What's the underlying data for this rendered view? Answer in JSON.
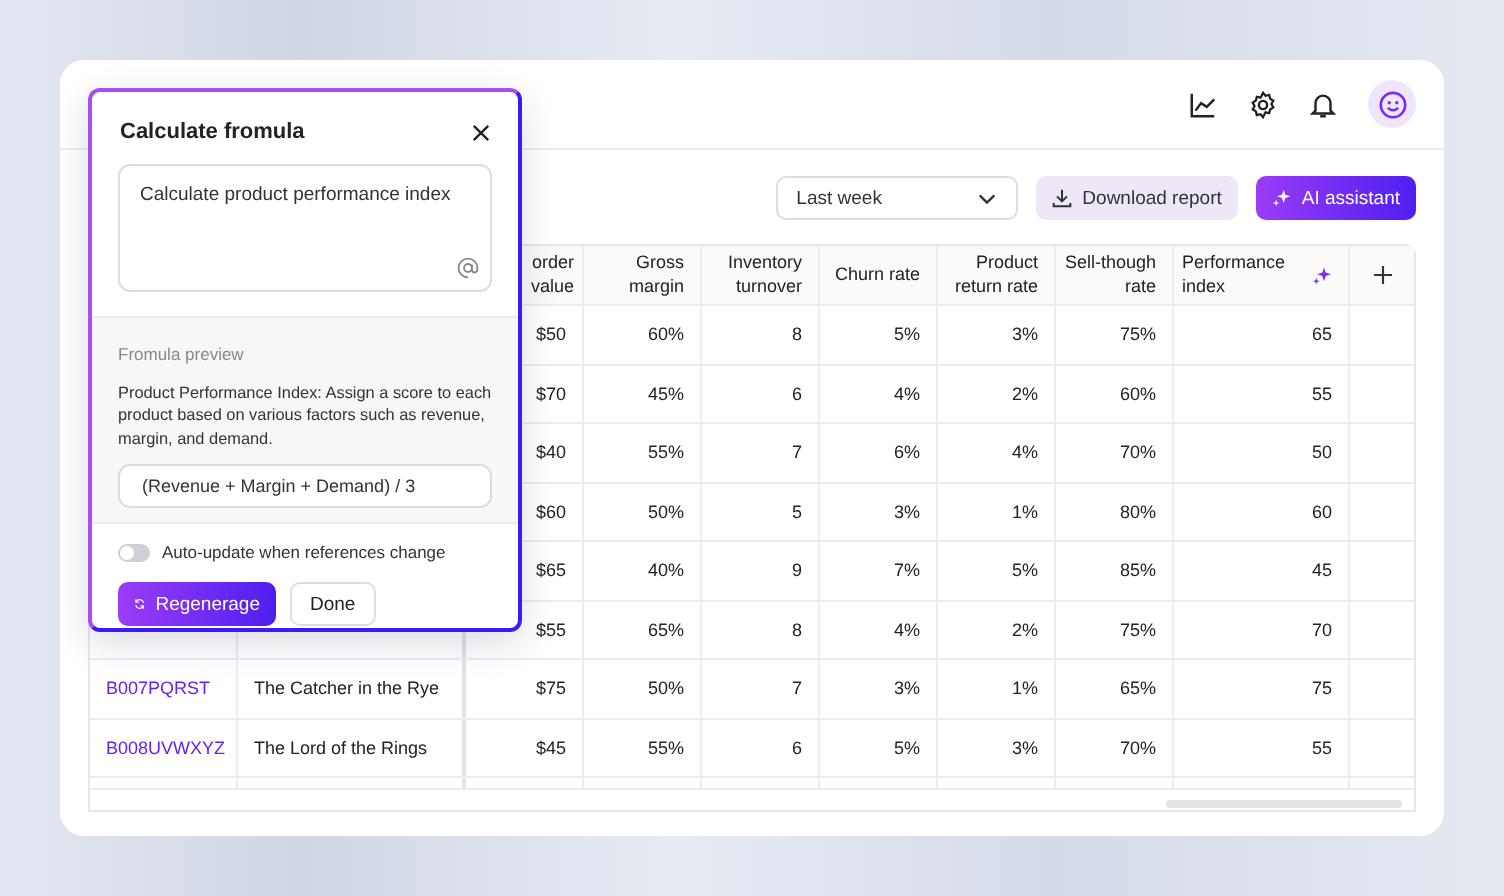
{
  "toolbar": {
    "period": "Last week",
    "download": "Download report",
    "assistant": "AI assistant"
  },
  "table": {
    "columns": [
      "order value",
      "Gross margin",
      "Inventory turnover",
      "Churn rate",
      "Product return rate",
      "Sell-though rate",
      "Performance index"
    ],
    "rows": [
      {
        "cells": [
          "$50",
          "60%",
          "8",
          "5%",
          "3%",
          "75%",
          "65"
        ]
      },
      {
        "cells": [
          "$70",
          "45%",
          "6",
          "4%",
          "2%",
          "60%",
          "55"
        ]
      },
      {
        "cells": [
          "$40",
          "55%",
          "7",
          "6%",
          "4%",
          "70%",
          "50"
        ]
      },
      {
        "cells": [
          "$60",
          "50%",
          "5",
          "3%",
          "1%",
          "80%",
          "60"
        ]
      },
      {
        "cells": [
          "$65",
          "40%",
          "9",
          "7%",
          "5%",
          "85%",
          "45"
        ]
      },
      {
        "cells": [
          "$55",
          "65%",
          "8",
          "4%",
          "2%",
          "75%",
          "70"
        ]
      },
      {
        "id": "B007PQRST",
        "title": "The Catcher in the Rye",
        "cells": [
          "$75",
          "50%",
          "7",
          "3%",
          "1%",
          "65%",
          "75"
        ]
      },
      {
        "id": "B008UVWXYZ",
        "title": "The Lord of the Rings",
        "cells": [
          "$45",
          "55%",
          "6",
          "5%",
          "3%",
          "70%",
          "55"
        ]
      }
    ]
  },
  "popup": {
    "title": "Calculate fromula",
    "prompt": "Calculate product performance index",
    "preview_label": "Fromula preview",
    "description": "Product Performance Index: Assign a score to each product based on various factors such as revenue, margin, and demand.",
    "formula": "(Revenue + Margin + Demand) / 3",
    "toggle": {
      "label": "Auto-update when references change",
      "on": false
    },
    "regenerate": "Regenerage",
    "done": "Done"
  }
}
